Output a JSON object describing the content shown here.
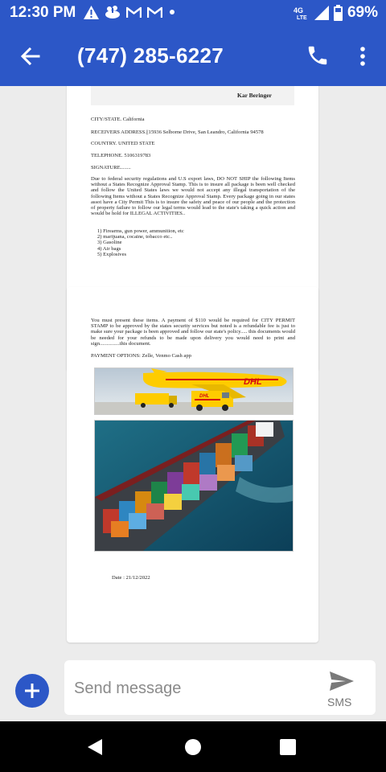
{
  "status_bar": {
    "time": "12:30 PM",
    "notification_icons": [
      "warning-icon",
      "chef-icon",
      "gmail-icon",
      "gmail-icon",
      "dot-icon"
    ],
    "network": "4G LTE",
    "battery": "69%"
  },
  "app_bar": {
    "title": "(747) 285-6227",
    "back_icon": "arrow-back-icon",
    "call_icon": "phone-icon",
    "menu_icon": "more-vert-icon"
  },
  "document_page1": {
    "name_header": "Kar Beringer",
    "city_state": "CITY/STATE. California",
    "address": "RECEIVERS ADDRESS.||15936 Selborne Drive, San Leandro, California 94578",
    "country": "COUNTRY.    UNITED STATE",
    "telephone": "TELEPHONE. 5106319783",
    "signature": "SIGNATURE........",
    "paragraph": "Due to federal security regulations and U.S export laws, DO NOT  SHIP  the following   Items without a States Recognize Approval Stamp.  This is to insure all package is been well checked and follow the United  States  laws we would not accept any illegal  transportation of the following Items without a States Recognize Approval Stamp. Every package going in our states assot have a City Permit This is to insure the safety and peace of our people and the protection of property failure to follow our legal terms would lead to the state's  taking a quick action and would be hold for ILLEGAL ACTIVITIES..",
    "items": [
      "1)  Firearms, gun power,  ammunition, etc",
      "2)  marijuana,  cocaine,  tobacco etc..",
      "3)  Gasoline",
      "4)  Air bags",
      "5)  Explosives"
    ]
  },
  "document_page2": {
    "paragraph": "You must present these items. A payment of $110 would be required for CITY PERMIT STAMP to be approved by the states security services but noted is a refundable fee is just to make sure your package is been approved and follow our state's policy.....  this  documents would be needed for your refunds to be made upon delivery  you would need to print and sign...............this document.",
    "payment_options": "PAYMENT  OPTIONS:  Zelle,  Venmo Cash app",
    "logo_text": "DHL",
    "date": "Date : 21/12/2022"
  },
  "compose": {
    "placeholder": "Send message",
    "send_label": "SMS",
    "add_icon": "plus-icon",
    "send_icon": "send-icon"
  },
  "nav_bar": {
    "back_icon": "nav-back-icon",
    "home_icon": "nav-home-icon",
    "recents_icon": "nav-recents-icon"
  },
  "colors": {
    "primary": "#2c57c7",
    "background": "#ececec",
    "dhl_yellow": "#fecc00",
    "dhl_red": "#d40511"
  }
}
